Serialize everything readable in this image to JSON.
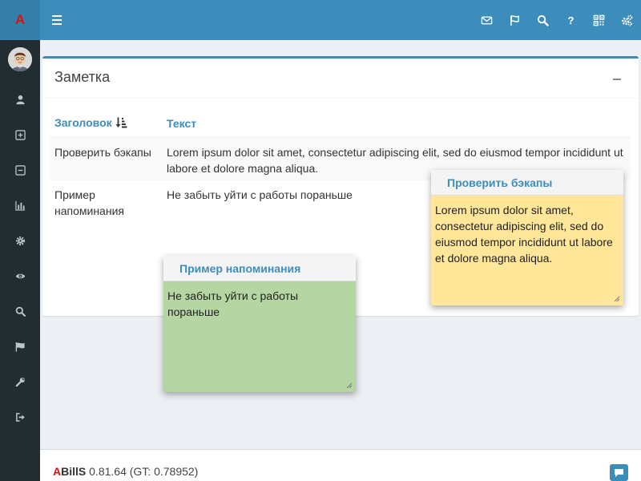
{
  "brand": {
    "logo_letter": "A",
    "logo_color": "#dd1111"
  },
  "topbar": {
    "color": "#3c8dbc",
    "icons": [
      "envelope-icon",
      "flag-icon",
      "search-icon",
      "help-icon",
      "qrcode-icon",
      "cogs-icon"
    ],
    "help_label": "?"
  },
  "sidebar": {
    "items": [
      "user-icon",
      "plus-square-icon",
      "minus-square-icon",
      "bar-chart-icon",
      "gear-icon",
      "eye-icon",
      "search-icon",
      "flag-icon",
      "wrench-icon",
      "sign-out-icon"
    ]
  },
  "box": {
    "title": "Заметка",
    "columns": {
      "title": "Заголовок",
      "text": "Текст"
    },
    "rows": [
      {
        "title": "Проверить бэкапы",
        "text": "Lorem ipsum dolor sit amet, consectetur adipiscing elit, sed do eiusmod tempor incididunt ut labore et dolore magna aliqua."
      },
      {
        "title": "Пример напоминания",
        "text": "Не забыть уйти с работы пораньше"
      }
    ]
  },
  "notes": [
    {
      "title": "Проверить бэкапы",
      "body": "Lorem ipsum dolor sit amet, consectetur adipiscing elit, sed do eiusmod tempor incididunt ut labore et dolore magna aliqua.",
      "color": "#ffe699"
    },
    {
      "title": "Пример напоминания",
      "body": "Не забыть уйти с работы пораньше",
      "color": "#b5d6a3"
    }
  ],
  "footer": {
    "brand_a": "A",
    "brand_rest": "BillS",
    "version": " 0.81.64 (GT: 0.78952)"
  }
}
